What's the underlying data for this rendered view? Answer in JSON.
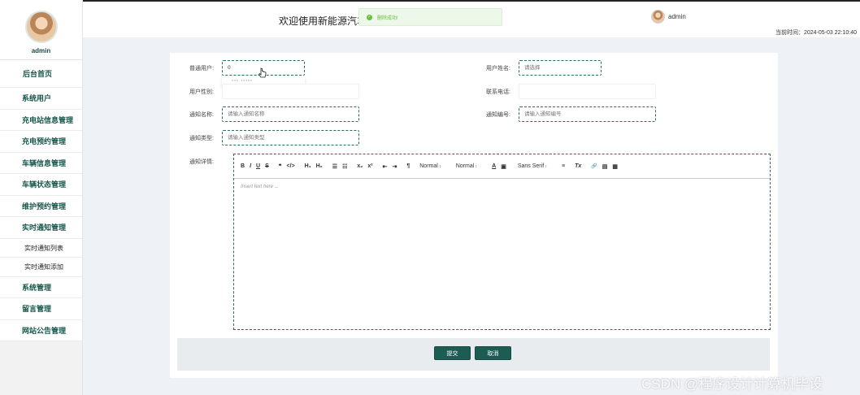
{
  "sidebar": {
    "username": "admin",
    "menu": [
      {
        "label": "后台首页",
        "type": "main"
      },
      {
        "label": "系统用户",
        "type": "item"
      },
      {
        "label": "充电站信息管理",
        "type": "item"
      },
      {
        "label": "充电预约管理",
        "type": "item"
      },
      {
        "label": "车辆信息管理",
        "type": "item"
      },
      {
        "label": "车辆状态管理",
        "type": "item"
      },
      {
        "label": "维护预约管理",
        "type": "item"
      },
      {
        "label": "实时通知管理",
        "type": "item"
      },
      {
        "label": "实时通知列表",
        "type": "sub"
      },
      {
        "label": "实时通知添加",
        "type": "sub"
      },
      {
        "label": "系统管理",
        "type": "item"
      },
      {
        "label": "留言管理",
        "type": "item"
      },
      {
        "label": "网站公告管理",
        "type": "item"
      }
    ]
  },
  "header": {
    "title": "欢迎使用新能源汽车服",
    "username": "admin",
    "time_label": "当前时间：2024-05-03 22:10:40"
  },
  "toast": {
    "icon": "check-icon",
    "text": "删除成功!"
  },
  "form": {
    "user_label": "普通用户:",
    "user_value": "0",
    "dropdown_hint": "*** *****",
    "username_label": "用户姓名:",
    "username_placeholder": "请选择",
    "gender_label": "用户性别:",
    "phone_label": "联系电话:",
    "notice_name_label": "通知名称:",
    "notice_name_placeholder": "请输入通知名称",
    "notice_no_label": "通知编号:",
    "notice_no_placeholder": "请输入通知编号",
    "notice_type_label": "通知类型:",
    "notice_type_placeholder": "请输入通知类型",
    "detail_label": "通知详情:"
  },
  "editor": {
    "toolbar": {
      "bold": "B",
      "italic": "I",
      "underline": "U",
      "strike": "S",
      "quote": "❞",
      "code": "</>",
      "h1": "H₁",
      "h2": "H₂",
      "ol": "☰",
      "ul": "☷",
      "sub": "x₂",
      "sup": "x²",
      "indent_less": "⇤",
      "indent_more": "⇥",
      "rtl": "¶",
      "size": "Normal",
      "header": "Normal",
      "color": "A",
      "bg": "▣",
      "font": "Sans Serif",
      "align": "≡",
      "clean": "Tx",
      "link": "🔗",
      "image": "▤",
      "video": "▦"
    },
    "placeholder": "Insert text here ..."
  },
  "actions": {
    "submit": "提交",
    "cancel": "取消"
  },
  "watermark": "CSDN @程序设计计算机毕设"
}
